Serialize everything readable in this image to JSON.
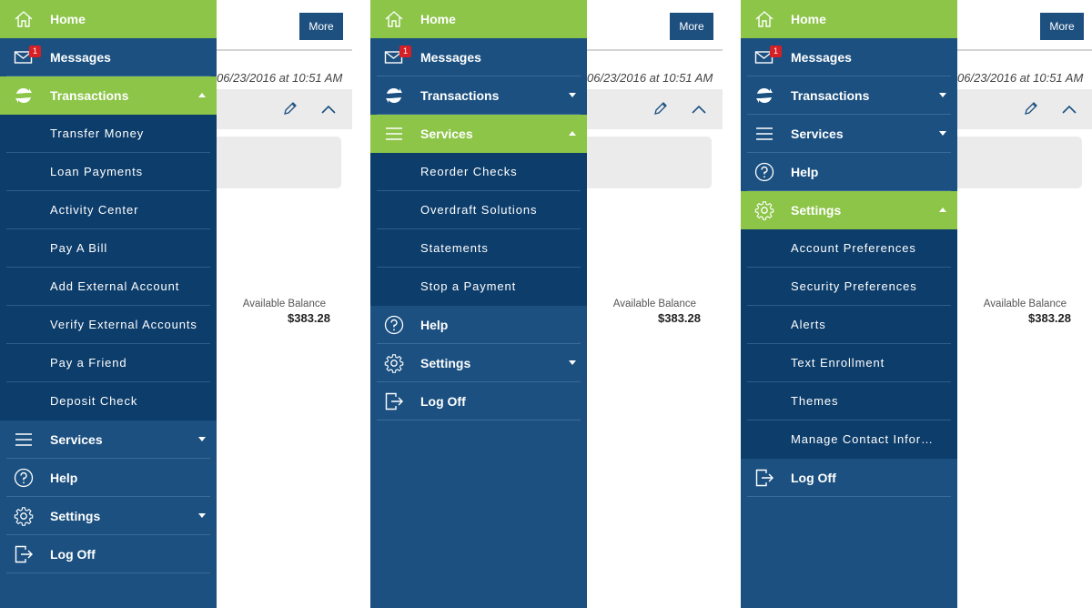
{
  "background": {
    "more_button": "More",
    "timestamp": "06/23/2016 at 10:51 AM",
    "available_balance_label": "Available Balance",
    "available_balance_value": "$383.28"
  },
  "panels": [
    {
      "home": "Home",
      "messages": "Messages",
      "messages_badge": "1",
      "transactions": "Transactions",
      "transactions_sub": [
        "Transfer Money",
        "Loan Payments",
        "Activity Center",
        "Pay A Bill",
        "Add External Account",
        "Verify External Accounts",
        "Pay a Friend",
        "Deposit Check"
      ],
      "services": "Services",
      "help": "Help",
      "settings": "Settings",
      "log_off": "Log Off"
    },
    {
      "home": "Home",
      "messages": "Messages",
      "messages_badge": "1",
      "transactions": "Transactions",
      "services": "Services",
      "services_sub": [
        "Reorder Checks",
        "Overdraft Solutions",
        "Statements",
        "Stop a Payment"
      ],
      "help": "Help",
      "settings": "Settings",
      "log_off": "Log Off"
    },
    {
      "home": "Home",
      "messages": "Messages",
      "messages_badge": "1",
      "transactions": "Transactions",
      "services": "Services",
      "help": "Help",
      "settings": "Settings",
      "settings_sub": [
        "Account Preferences",
        "Security Preferences",
        "Alerts",
        "Text Enrollment",
        "Themes",
        "Manage Contact Information"
      ],
      "log_off": "Log Off"
    }
  ],
  "colors": {
    "drawer_bg": "#1b5080",
    "submenu_bg": "#0d3d6b",
    "active_green": "#8cc548",
    "badge_red": "#d71f26",
    "button_blue": "#1d4f7f"
  },
  "icons": [
    "home-icon",
    "envelope-icon",
    "refresh-icon",
    "hamburger-icon",
    "help-icon",
    "gear-icon",
    "logout-icon",
    "pencil-icon",
    "chevron-up-icon"
  ]
}
